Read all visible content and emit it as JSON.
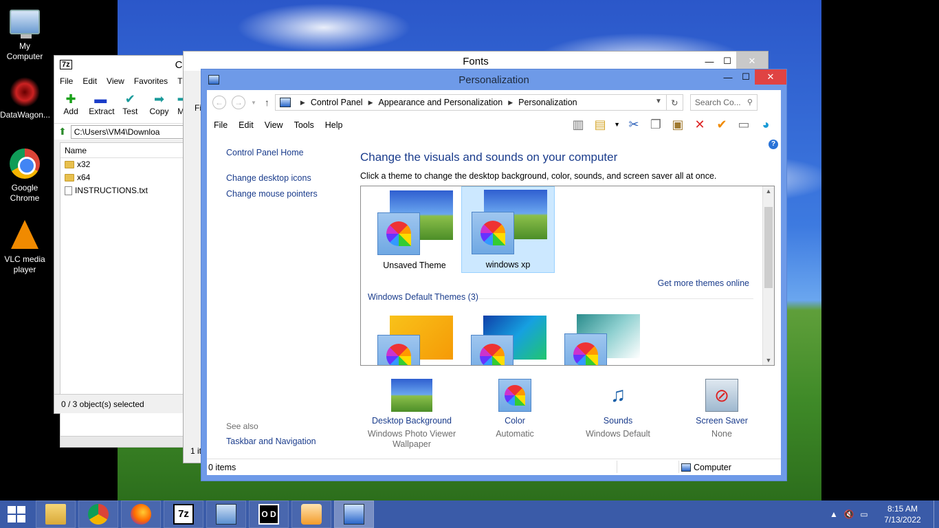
{
  "desktop": {
    "icons": [
      {
        "label": "My Computer",
        "icon": "computer-icon"
      },
      {
        "label": "DataWagon...",
        "icon": "datawagon-icon"
      },
      {
        "label": "Google Chrome",
        "icon": "chrome-icon"
      },
      {
        "label": "VLC media player",
        "icon": "vlc-icon"
      }
    ]
  },
  "sevenzip": {
    "title_fragment": "C:",
    "logo": "7z",
    "menu": [
      "File",
      "Edit",
      "View",
      "Favorites",
      "T"
    ],
    "tools": [
      {
        "label": "Add",
        "icon": "add-icon"
      },
      {
        "label": "Extract",
        "icon": "extract-icon"
      },
      {
        "label": "Test",
        "icon": "test-icon"
      },
      {
        "label": "Copy",
        "icon": "copy-icon"
      },
      {
        "label": "M",
        "icon": "move-icon"
      }
    ],
    "path": "C:\\Users\\VM4\\Downloa",
    "column_name": "Name",
    "files": [
      {
        "name": "x32",
        "type": "folder"
      },
      {
        "name": "x64",
        "type": "folder"
      },
      {
        "name": "INSTRUCTIONS.txt",
        "type": "file"
      }
    ],
    "status": "0 / 3 object(s) selected"
  },
  "fonts": {
    "title": "Fonts",
    "fragment_top": "Fi",
    "fragment_status": "1 it"
  },
  "personalization": {
    "title": "Personalization",
    "breadcrumb": [
      "Control Panel",
      "Appearance and Personalization",
      "Personalization"
    ],
    "search_placeholder": "Search Co...",
    "menu": [
      "File",
      "Edit",
      "View",
      "Tools",
      "Help"
    ],
    "left_links": [
      "Control Panel Home",
      "Change desktop icons",
      "Change mouse pointers"
    ],
    "heading": "Change the visuals and sounds on your computer",
    "subheading": "Click a theme to change the desktop background, color, sounds, and screen saver all at once.",
    "themes": [
      {
        "name": "Unsaved Theme",
        "selected": false
      },
      {
        "name": "windows xp",
        "selected": true
      }
    ],
    "get_more": "Get more themes online",
    "group_label": "Windows Default Themes (3)",
    "bottom_items": [
      {
        "label": "Desktop Background",
        "sub": "Windows Photo Viewer Wallpaper"
      },
      {
        "label": "Color",
        "sub": "Automatic"
      },
      {
        "label": "Sounds",
        "sub": "Windows Default"
      },
      {
        "label": "Screen Saver",
        "sub": "None"
      }
    ],
    "see_also": "See also",
    "see_also_link": "Taskbar and Navigation",
    "status_items": "0 items",
    "status_location": "Computer"
  },
  "taskbar": {
    "apps": [
      "file-explorer",
      "chrome",
      "firefox",
      "7zip",
      "installer",
      "oodi",
      "media-player",
      "control-panel"
    ],
    "time": "8:15 AM",
    "date": "7/13/2022"
  },
  "colors": {
    "accent": "#6e9ae8",
    "taskbar": "#3a5ba8",
    "link": "#1a3c8c",
    "close": "#e04343"
  }
}
